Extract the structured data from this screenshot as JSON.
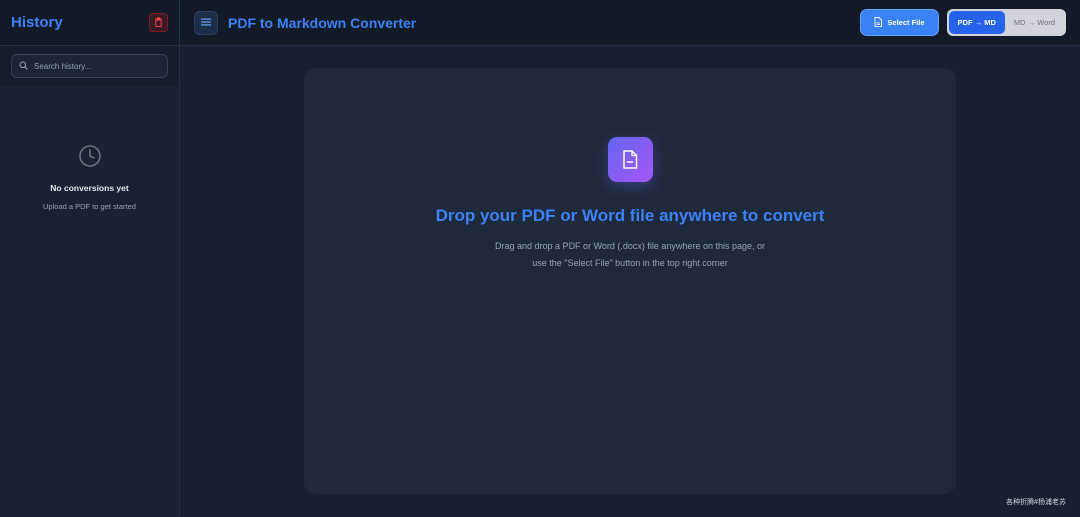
{
  "sidebar": {
    "title": "History",
    "trash_icon": "trash-icon",
    "search": {
      "placeholder": "Search history..."
    },
    "empty": {
      "icon": "clock-icon",
      "title": "No conversions yet",
      "subtitle": "Upload a PDF to get started"
    }
  },
  "header": {
    "menu_icon": "menu-icon",
    "title": "PDF to Markdown Converter",
    "select_file_label": "Select File",
    "modes": [
      {
        "label": "PDF → MD",
        "active": true
      },
      {
        "label": "MD → Word",
        "active": false
      }
    ]
  },
  "main": {
    "icon": "document-icon",
    "title": "Drop your PDF or Word file anywhere to convert",
    "description": "Drag and drop a PDF or Word (.docx) file anywhere on this page, or use the \"Select File\" button in the top right corner"
  },
  "watermark": "各种折腾#杨浦老苏",
  "colors": {
    "accent": "#3b82f6",
    "danger": "#ef4444",
    "background": "#162030",
    "card": "#1e293b",
    "icon_gradient_start": "#6366f1",
    "icon_gradient_end": "#a855f7"
  }
}
